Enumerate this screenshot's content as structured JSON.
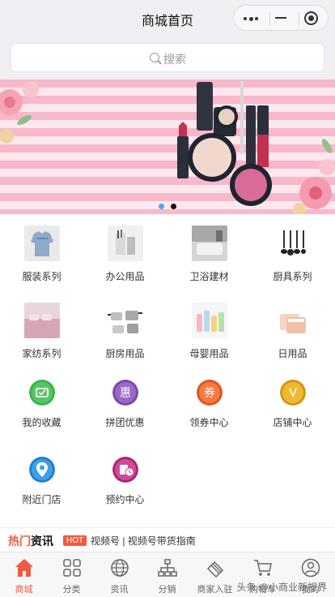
{
  "header": {
    "title": "商城首页"
  },
  "search": {
    "placeholder": "搜索"
  },
  "banner": {
    "dot_colors": [
      "#4aa3ff",
      "#111111"
    ]
  },
  "grid": {
    "items": [
      {
        "label": "服装系列",
        "icon": "clothing-thumbnail-icon"
      },
      {
        "label": "办公用品",
        "icon": "office-supplies-thumbnail-icon"
      },
      {
        "label": "卫浴建材",
        "icon": "bathroom-thumbnail-icon"
      },
      {
        "label": "厨具系列",
        "icon": "kitchen-utensils-thumbnail-icon"
      },
      {
        "label": "家纺系列",
        "icon": "home-textile-thumbnail-icon"
      },
      {
        "label": "厨房用品",
        "icon": "cookware-thumbnail-icon"
      },
      {
        "label": "母婴用品",
        "icon": "baby-products-thumbnail-icon"
      },
      {
        "label": "日用品",
        "icon": "daily-goods-thumbnail-icon"
      },
      {
        "label": "我的收藏",
        "icon": "favorites-icon",
        "color": "#3bb54a"
      },
      {
        "label": "拼团优惠",
        "icon": "group-buy-icon",
        "color": "#8c5bb5",
        "glyph": "惠"
      },
      {
        "label": "领券中心",
        "icon": "coupon-icon",
        "color": "#f26a2e",
        "glyph": "券"
      },
      {
        "label": "店铺中心",
        "icon": "store-icon",
        "color": "#e3a51a",
        "glyph": "V"
      },
      {
        "label": "附近门店",
        "icon": "location-pin-icon",
        "color": "#2f8fd8"
      },
      {
        "label": "预约中心",
        "icon": "reservation-clock-icon",
        "color": "#c23b8b"
      }
    ]
  },
  "news": {
    "brand_a": "热门",
    "brand_b": "资讯",
    "hot": "HOT",
    "text": "视频号 | 视频号带货指南"
  },
  "tabbar": {
    "items": [
      {
        "label": "商城",
        "icon": "home-icon",
        "active": true
      },
      {
        "label": "分类",
        "icon": "category-icon"
      },
      {
        "label": "资讯",
        "icon": "globe-icon"
      },
      {
        "label": "分销",
        "icon": "distribution-icon"
      },
      {
        "label": "商家入驻",
        "icon": "merchant-icon"
      },
      {
        "label": "购物车",
        "icon": "cart-icon"
      },
      {
        "label": "我的",
        "icon": "profile-icon"
      }
    ]
  },
  "watermark": "头条 @小商业新视界",
  "colors": {
    "accent": "#f25a3f",
    "header_bg": "#efeff4"
  }
}
